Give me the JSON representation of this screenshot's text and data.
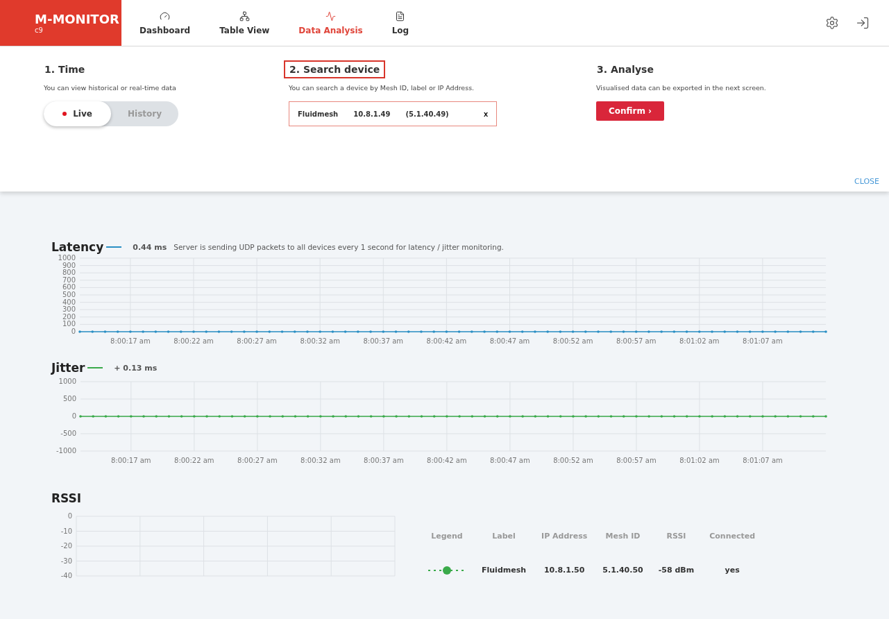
{
  "app": {
    "logo": "M-MONITOR",
    "version": "c9"
  },
  "nav": [
    {
      "label": "Dashboard",
      "selected": false
    },
    {
      "label": "Table View",
      "selected": false
    },
    {
      "label": "Data Analysis",
      "selected": true
    },
    {
      "label": "Log",
      "selected": false
    }
  ],
  "steps": [
    {
      "kind": "time",
      "title": "1. Time",
      "description": "You can view historical or real-time data",
      "highlighted": false,
      "options": [
        {
          "label": "Live",
          "selected": true
        },
        {
          "label": "History",
          "selected": false
        }
      ]
    },
    {
      "kind": "search",
      "title": "2. Search device",
      "description": "You can search a device by Mesh ID, label or IP Address.",
      "highlighted": true,
      "device": {
        "label": "Fluidmesh",
        "ip": "10.8.1.49",
        "mesh_id": "(5.1.40.49)",
        "clear": "x"
      }
    },
    {
      "kind": "confirm",
      "title": "3. Analyse",
      "description": "Visualised data can be exported in the next screen.",
      "highlighted": false,
      "button": "Confirm",
      "button_icon": "›"
    }
  ],
  "close": "CLOSE",
  "latency": {
    "title": "Latency",
    "color": "#2a8fc4",
    "reading": "0.44 ms",
    "note": "Server is sending UDP packets to all devices every 1 second for latency / jitter monitoring.",
    "chart_data": {
      "type": "line",
      "grid": true,
      "ylim": [
        0,
        1000
      ],
      "yticks": [
        0,
        100,
        200,
        300,
        400,
        500,
        600,
        700,
        800,
        900,
        1000
      ],
      "categories": [
        null,
        null,
        null,
        null,
        "8:00:17 am",
        null,
        null,
        null,
        null,
        "8:00:22 am",
        null,
        null,
        null,
        null,
        "8:00:27 am",
        null,
        null,
        null,
        null,
        "8:00:32 am",
        null,
        null,
        null,
        null,
        "8:00:37 am",
        null,
        null,
        null,
        null,
        "8:00:42 am",
        null,
        null,
        null,
        null,
        "8:00:47 am",
        null,
        null,
        null,
        null,
        "8:00:52 am",
        null,
        null,
        null,
        null,
        "8:00:57 am",
        null,
        null,
        null,
        null,
        "8:01:02 am",
        null,
        null,
        null,
        null,
        "8:01:07 am",
        null,
        null,
        null,
        null,
        null
      ],
      "series": [
        {
          "color": "#2a8fc4",
          "values": [
            0,
            0,
            0,
            0,
            0,
            0,
            0,
            0,
            0,
            0,
            0,
            0,
            0,
            0,
            0,
            0,
            0,
            0,
            0,
            0,
            0,
            0,
            0,
            0,
            0,
            0,
            0,
            0,
            0,
            0,
            0,
            0,
            0,
            0,
            0,
            0,
            0,
            0,
            0,
            0,
            0,
            0,
            0,
            0,
            0,
            0,
            0,
            0,
            0,
            0,
            0,
            0,
            0,
            0,
            0,
            0,
            0,
            0,
            0,
            0
          ]
        }
      ]
    }
  },
  "jitter": {
    "title": "Jitter",
    "color": "#3aaa4a",
    "reading": "+ 0.13 ms",
    "chart_data": {
      "type": "line",
      "grid": true,
      "ylim": [
        -1000,
        1000
      ],
      "yticks": [
        -1000,
        -500,
        0,
        500,
        1000
      ],
      "categories": [
        null,
        null,
        null,
        null,
        "8:00:17 am",
        null,
        null,
        null,
        null,
        "8:00:22 am",
        null,
        null,
        null,
        null,
        "8:00:27 am",
        null,
        null,
        null,
        null,
        "8:00:32 am",
        null,
        null,
        null,
        null,
        "8:00:37 am",
        null,
        null,
        null,
        null,
        "8:00:42 am",
        null,
        null,
        null,
        null,
        "8:00:47 am",
        null,
        null,
        null,
        null,
        "8:00:52 am",
        null,
        null,
        null,
        null,
        "8:00:57 am",
        null,
        null,
        null,
        null,
        "8:01:02 am",
        null,
        null,
        null,
        null,
        "8:01:07 am",
        null,
        null,
        null,
        null,
        null
      ],
      "series": [
        {
          "color": "#3aaa4a",
          "values": [
            0,
            0,
            0,
            0,
            0,
            0,
            0,
            0,
            0,
            0,
            0,
            0,
            0,
            0,
            0,
            0,
            0,
            0,
            0,
            0,
            0,
            0,
            0,
            0,
            0,
            0,
            0,
            0,
            0,
            0,
            0,
            0,
            0,
            0,
            0,
            0,
            0,
            0,
            0,
            0,
            0,
            0,
            0,
            0,
            0,
            0,
            0,
            0,
            0,
            0,
            0,
            0,
            0,
            0,
            0,
            0,
            0,
            0,
            0,
            0
          ]
        }
      ]
    }
  },
  "rssi": {
    "title": "RSSI",
    "chart_data": {
      "type": "line",
      "grid": true,
      "ylim": [
        -40,
        0
      ],
      "yticks": [
        0,
        -10,
        -20,
        -30,
        -40
      ],
      "categories": [
        null,
        null,
        null,
        null,
        null,
        null
      ]
    },
    "table": {
      "columns": [
        "Legend",
        "Label",
        "IP Address",
        "Mesh ID",
        "RSSI",
        "Connected"
      ],
      "rows": [
        {
          "color": "#3aaa4a",
          "label": "Fluidmesh",
          "ip": "10.8.1.50",
          "mesh_id": "5.1.40.50",
          "rssi": "-58 dBm",
          "connected": "yes"
        }
      ]
    }
  }
}
